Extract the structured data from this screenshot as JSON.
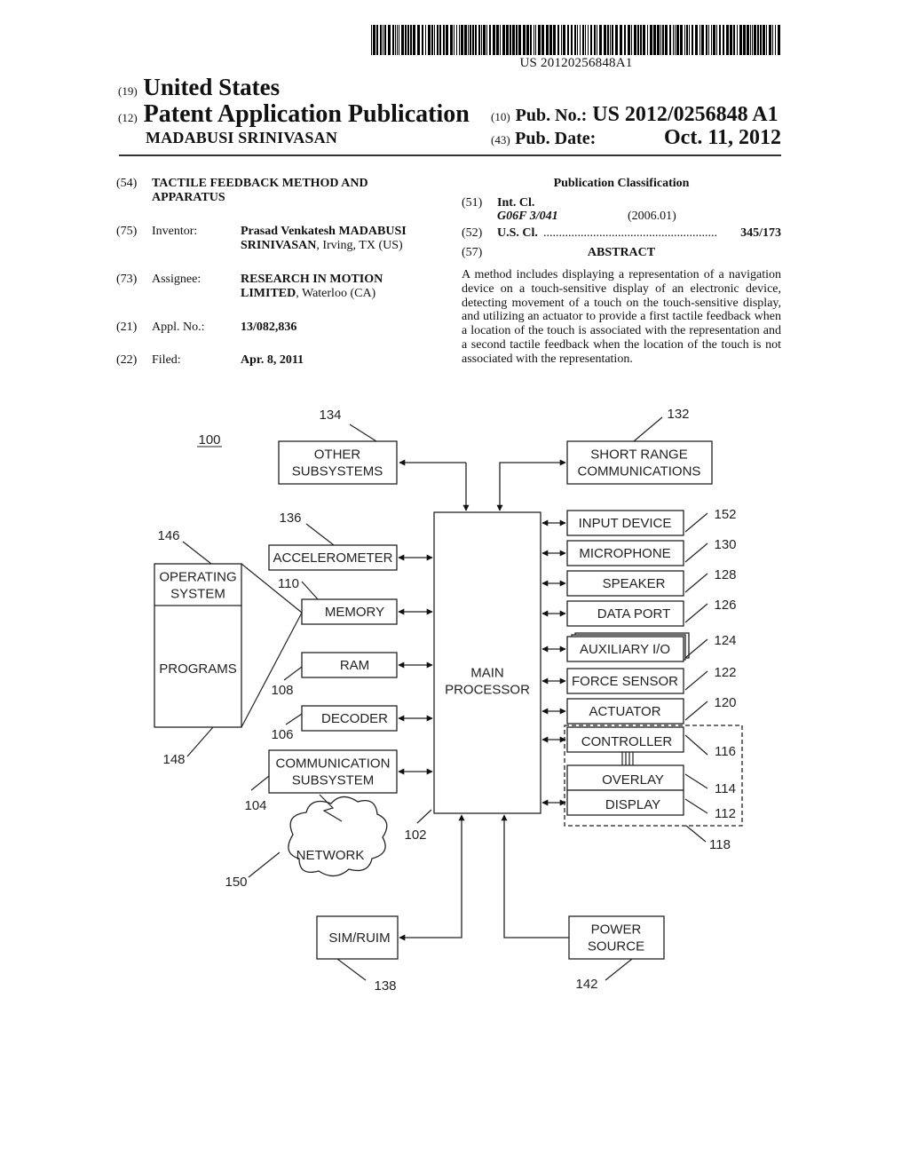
{
  "header": {
    "barcode_number": "US 20120256848A1",
    "country_code": "(19)",
    "country": "United States",
    "pubtype_code": "(12)",
    "pub_type": "Patent Application Publication",
    "inventor_surname": "MADABUSI SRINIVASAN",
    "pub_no_code": "(10)",
    "pub_no_label": "Pub. No.:",
    "pub_no": "US 2012/0256848 A1",
    "pub_date_code": "(43)",
    "pub_date_label": "Pub. Date:",
    "pub_date": "Oct. 11, 2012"
  },
  "biblio": {
    "title": {
      "code": "(54)",
      "line1": "TACTILE FEEDBACK METHOD AND",
      "line2": "APPARATUS"
    },
    "inventor": {
      "code": "(75)",
      "label": "Inventor:",
      "name_line1": "Prasad Venkatesh MADABUSI",
      "name_bold2": "SRINIVASAN",
      "name_rest2": ", Irving, TX (US)"
    },
    "assignee": {
      "code": "(73)",
      "label": "Assignee:",
      "line1": "RESEARCH IN MOTION",
      "bold2": "LIMITED",
      "rest2": ", Waterloo (CA)"
    },
    "appl": {
      "code": "(21)",
      "label": "Appl. No.:",
      "value": "13/082,836"
    },
    "filed": {
      "code": "(22)",
      "label": "Filed:",
      "value": "Apr. 8, 2011"
    }
  },
  "classification": {
    "title": "Publication Classification",
    "int_cl": {
      "code": "(51)",
      "label": "Int. Cl.",
      "class": "G06F 3/041",
      "version": "(2006.01)"
    },
    "us_cl": {
      "code": "(52)",
      "label": "U.S. Cl.",
      "dots": "........................................................",
      "value": "345/173"
    },
    "abstract": {
      "code": "(57)",
      "title": "ABSTRACT",
      "text": "A method includes displaying a representation of a navigation device on a touch-sensitive display of an electronic device, detecting movement of a touch on the touch-sensitive display, and utilizing an actuator to provide a first tactile feedback when a location of the touch is associated with the representation and a second tactile feedback when the location of the touch is not associated with the representation."
    }
  },
  "diagram": {
    "figure_ref": "100",
    "main_processor": {
      "lines": [
        "MAIN",
        "PROCESSOR"
      ],
      "ref": "102"
    },
    "top_blocks": [
      {
        "id": "other",
        "lines": [
          "OTHER",
          "SUBSYSTEMS"
        ],
        "ref": "134"
      },
      {
        "id": "short-range",
        "lines": [
          "SHORT RANGE",
          "COMMUNICATIONS"
        ],
        "ref": "132"
      }
    ],
    "left_blocks": [
      {
        "id": "accelerometer",
        "lines": [
          "ACCELEROMETER"
        ],
        "ref": "136"
      },
      {
        "id": "memory",
        "lines": [
          "MEMORY"
        ],
        "ref": "110"
      },
      {
        "id": "ram",
        "lines": [
          "RAM"
        ],
        "ref": "108"
      },
      {
        "id": "decoder",
        "lines": [
          "DECODER"
        ],
        "ref": "106"
      },
      {
        "id": "comm",
        "lines": [
          "COMMUNICATION",
          "SUBSYSTEM"
        ],
        "ref": "104"
      }
    ],
    "memory_contents": {
      "os_lines": [
        "OPERATING",
        "SYSTEM"
      ],
      "os_ref": "146",
      "programs": "PROGRAMS",
      "programs_ref": "148"
    },
    "network": {
      "label": "NETWORK",
      "ref": "150"
    },
    "right_blocks": [
      {
        "id": "input-device",
        "label": "INPUT DEVICE",
        "ref": "152"
      },
      {
        "id": "microphone",
        "label": "MICROPHONE",
        "ref": "130"
      },
      {
        "id": "speaker",
        "label": "SPEAKER",
        "ref": "128"
      },
      {
        "id": "data-port",
        "label": "DATA PORT",
        "ref": "126"
      },
      {
        "id": "aux-io",
        "label": "AUXILIARY I/O",
        "ref": "124"
      },
      {
        "id": "force-sensor",
        "label": "FORCE SENSOR",
        "ref": "122"
      },
      {
        "id": "actuator",
        "label": "ACTUATOR",
        "ref": "120"
      }
    ],
    "touch_display": {
      "ref": "118",
      "controller": "CONTROLLER",
      "controller_ref": "116",
      "overlay": "OVERLAY",
      "overlay_ref": "114",
      "display": "DISPLAY",
      "display_ref": "112"
    },
    "bottom_blocks": [
      {
        "id": "sim",
        "lines": [
          "SIM/RUIM"
        ],
        "ref": "138"
      },
      {
        "id": "power",
        "lines": [
          "POWER",
          "SOURCE"
        ],
        "ref": "142"
      }
    ]
  }
}
